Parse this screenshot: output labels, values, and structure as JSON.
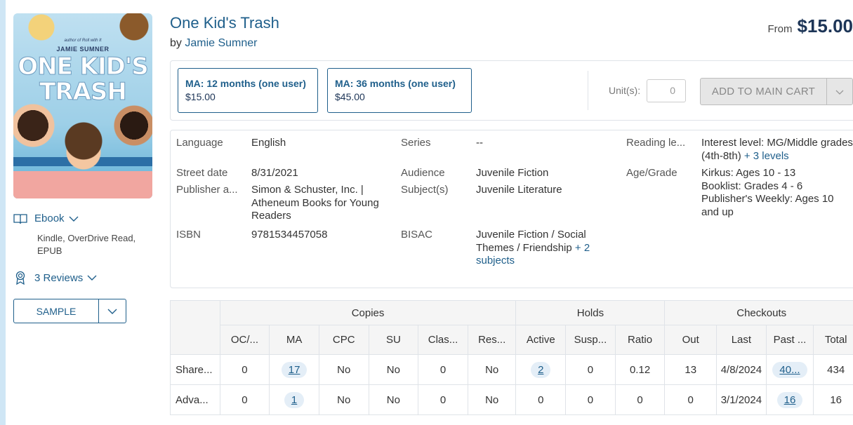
{
  "book": {
    "title": "One Kid's Trash",
    "by_prefix": "by",
    "author": "Jamie Sumner",
    "price_prefix": "From",
    "price": "$15.00",
    "cover": {
      "author_prefix": "author of Roll with It",
      "author": "JAMIE SUMNER",
      "title_line1": "ONE KID'S",
      "title_line2": "TRASH"
    }
  },
  "format": {
    "label": "Ebook",
    "icon": "book-icon",
    "sub": "Kindle, OverDrive Read, EPUB"
  },
  "reviews": {
    "label": "3 Reviews",
    "icon": "award-icon"
  },
  "sample": {
    "label": "SAMPLE"
  },
  "licenses": [
    {
      "name": "MA: 12 months (one user)",
      "price": "$15.00"
    },
    {
      "name": "MA: 36 months (one user)",
      "price": "$45.00"
    }
  ],
  "cart": {
    "units_label": "Unit(s):",
    "units_placeholder": "0",
    "add_label": "ADD TO MAIN CART"
  },
  "details": {
    "language_k": "Language",
    "language_v": "English",
    "series_k": "Series",
    "series_v": "--",
    "reading_k": "Reading le...",
    "reading_v": "Interest level: MG/Middle grades (4th-8th)",
    "reading_more": "+ 3 levels",
    "street_k": "Street date",
    "street_v": "8/31/2021",
    "audience_k": "Audience",
    "audience_v": "Juvenile Fiction",
    "age_k": "Age/Grade",
    "age_v1": "Kirkus: Ages 10 - 13",
    "age_v2": "Booklist: Grades 4 - 6",
    "age_v3": "Publisher's Weekly: Ages 10 and up",
    "publisher_k": "Publisher a...",
    "publisher_v": "Simon & Schuster, Inc. | Atheneum Books for Young Readers",
    "subject_k": "Subject(s)",
    "subject_v": "Juvenile Literature",
    "isbn_k": "ISBN",
    "isbn_v": "9781534457058",
    "bisac_k": "BISAC",
    "bisac_v": "Juvenile Fiction / Social Themes / Friendship",
    "bisac_more": "+ 2 subjects"
  },
  "table": {
    "groups": [
      "Copies",
      "Holds",
      "Checkouts"
    ],
    "headers": [
      "OC/...",
      "MA",
      "CPC",
      "SU",
      "Clas...",
      "Res...",
      "Active",
      "Susp...",
      "Ratio",
      "Out",
      "Last",
      "Past ...",
      "Total"
    ],
    "rows": [
      {
        "label": "Share...",
        "cells": [
          "0",
          "17",
          "No",
          "No",
          "0",
          "No",
          "2",
          "0",
          "0.12",
          "13",
          "4/8/2024",
          "40...",
          "434"
        ]
      },
      {
        "label": "Adva...",
        "cells": [
          "0",
          "1",
          "No",
          "No",
          "0",
          "No",
          "0",
          "0",
          "0",
          "0",
          "3/1/2024",
          "16",
          "16"
        ]
      }
    ]
  },
  "colors": {
    "link": "#1f5f8b",
    "border": "#dfe3e8",
    "page_bg": "#cfe6f5"
  }
}
